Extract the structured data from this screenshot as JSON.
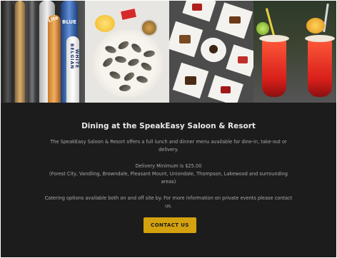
{
  "hero": {
    "panels": [
      "beer-taps-photo",
      "mussels-photo",
      "desserts-photo",
      "red-cocktails-photo"
    ],
    "tap_labels": {
      "lite": "Lite",
      "blue": "BLUE",
      "belgian": "BELGIAN",
      "white": "WHITE"
    }
  },
  "section": {
    "title": "Dining at the SpeakEasy Saloon & Resort",
    "intro": "The SpeakEasy Saloon & Resort offers a full lunch and dinner menu available for dine-in, take-out or delivery.",
    "delivery_minimum": "Delivery Minimum is $25.00",
    "delivery_areas": "(Forest City, Vandling, Browndale, Pleasant Mount, Uniondale, Thompson, Lakewood and surrounding areas)",
    "catering": "Catering options available both on and off site by.  For more information on private events please contact us.",
    "cta_label": "CONTACT US"
  },
  "colors": {
    "background": "#1c1c1c",
    "accent": "#d4a20e",
    "title_text": "#e8e8e8",
    "body_text": "#a9a9a9"
  }
}
